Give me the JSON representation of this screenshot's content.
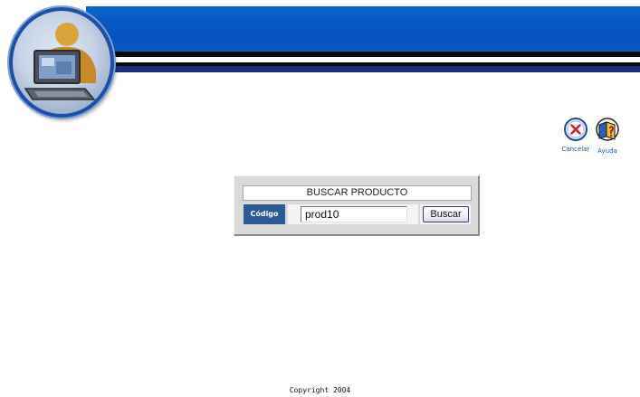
{
  "header": {
    "brand_colors": {
      "banner_blue": "#0753bf",
      "stripe_dark": "#0b0b0b",
      "stripe_navy": "#1a2e7a"
    },
    "logo_icon": "computer-user-icon"
  },
  "actions": [
    {
      "id": "cancel",
      "label": "Cancelar",
      "icon": "cancel-x-icon"
    },
    {
      "id": "help",
      "label": "Ayuda",
      "icon": "help-book-icon"
    }
  ],
  "search_form": {
    "title": "BUSCAR PRODUCTO",
    "code_label": "Código",
    "code_value": "prod10",
    "search_button_label": "Buscar",
    "accent_color": "#2c5a92"
  },
  "footer": {
    "copyright": "Copyright 2004"
  }
}
